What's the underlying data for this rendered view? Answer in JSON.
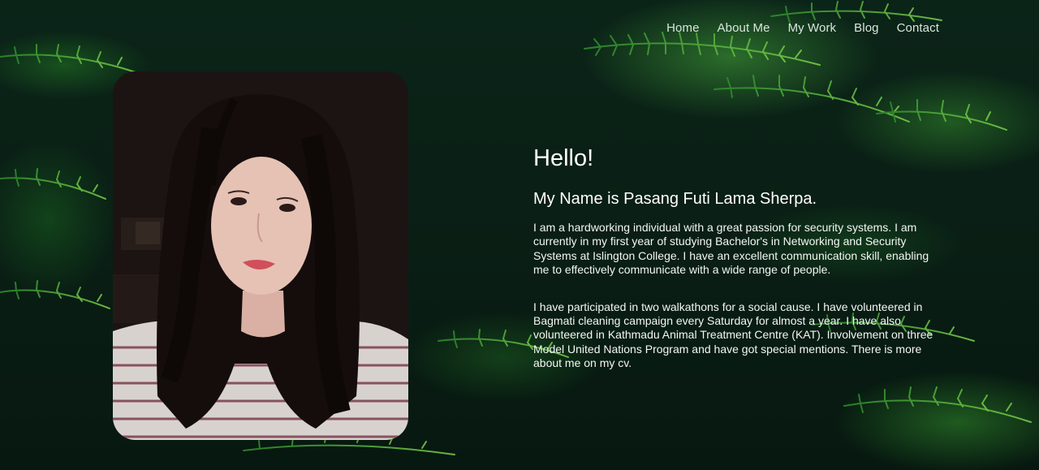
{
  "nav": {
    "items": [
      {
        "label": "Home"
      },
      {
        "label": "About Me"
      },
      {
        "label": "My Work"
      },
      {
        "label": "Blog"
      },
      {
        "label": "Contact"
      }
    ]
  },
  "hero": {
    "greeting": "Hello!",
    "name_line": "My Name is Pasang Futi Lama Sherpa.",
    "paragraph_1": "I am a hardworking individual with a great passion for security systems. I am currently in my first year of studying Bachelor's in Networking and Security Systems at Islington College. I have an excellent communication skill, enabling me to effectively communicate with a wide range of people.",
    "paragraph_2": "I have participated in two walkathons for a social cause. I have volunteered in Bagmati cleaning campaign every Saturday for almost a year. I have also volunteered in Kathmadu Animal Treatment Centre (KAT). Involvement on three Model United Nations Program and have got special mentions. There is more about me on my cv."
  },
  "colors": {
    "background": "#0a1f15",
    "fern_green": "#3fae3a",
    "text": "#ffffff",
    "nav_text": "#d8e6dc"
  }
}
